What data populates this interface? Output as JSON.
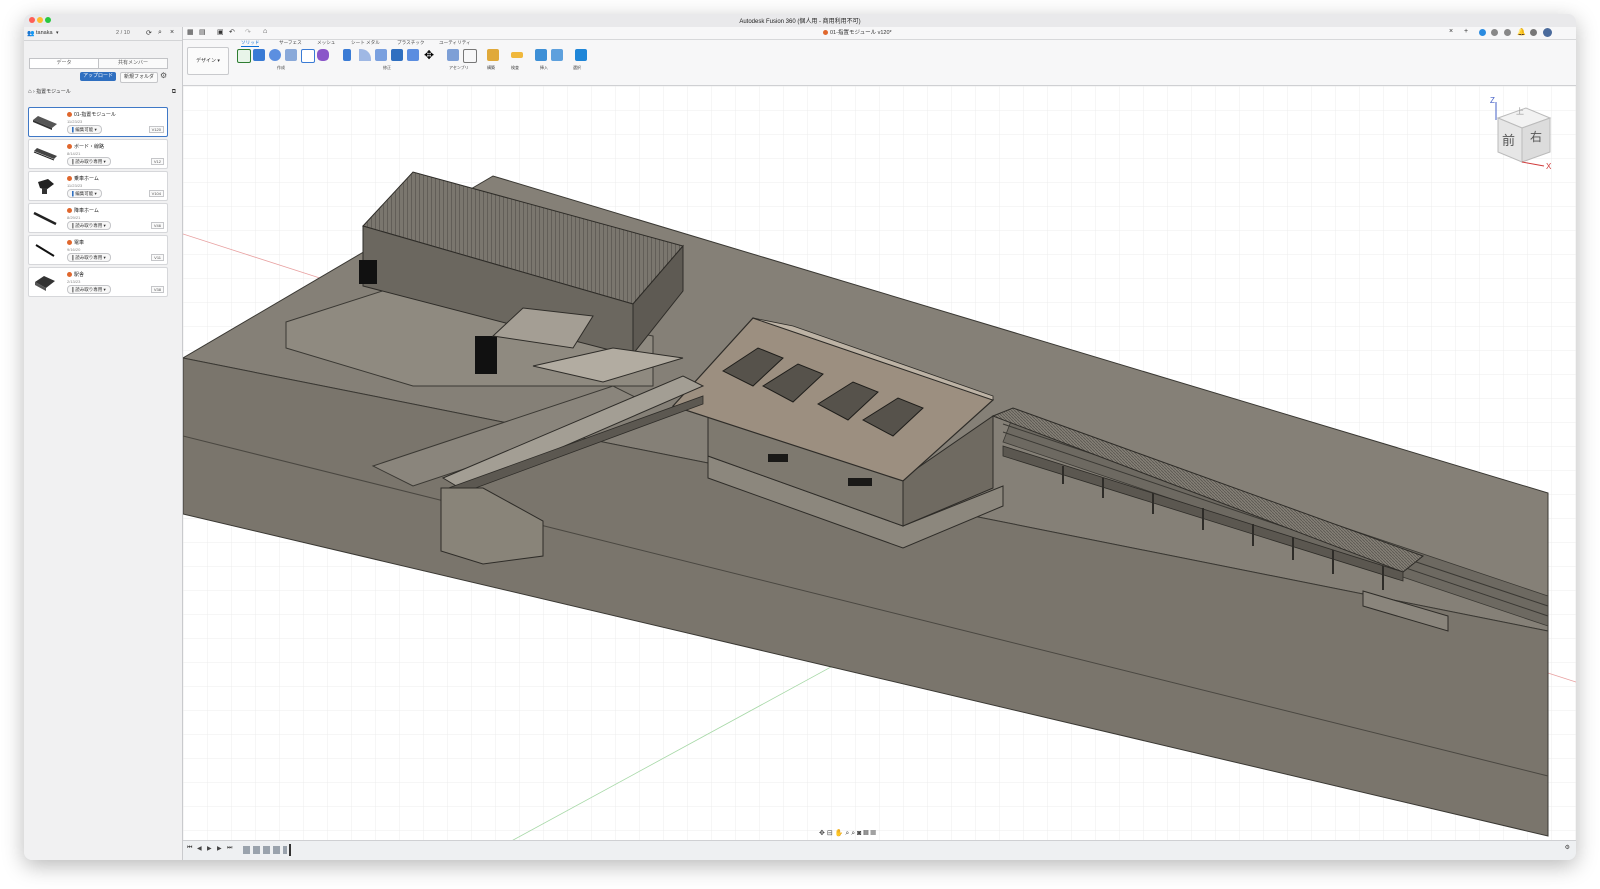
{
  "window": {
    "title": "Autodesk Fusion 360 (個人用 - 商用利用不可)",
    "document_tab": "01-指置モジュール v120*"
  },
  "sidebar": {
    "user": "tanaka",
    "job_status": "2 / 10",
    "tabs": [
      "データ",
      "共有メンバー"
    ],
    "upload_label": "アップロード",
    "new_folder_label": "新規フォルダ",
    "breadcrumb": "指置モジュール",
    "items": [
      {
        "name": "01-指置モジュール",
        "date": "11/23/23",
        "perm": "編集可能",
        "version": "V120",
        "selected": true
      },
      {
        "name": "ボード・線路",
        "date": "8/14/21",
        "perm": "読み取り専用",
        "version": "V12"
      },
      {
        "name": "乗車ホーム",
        "date": "11/23/23",
        "perm": "編集可能",
        "version": "V104"
      },
      {
        "name": "降車ホーム",
        "date": "8/29/21",
        "perm": "読み取り専用",
        "version": "V46"
      },
      {
        "name": "電車",
        "date": "9/16/20",
        "perm": "読み取り専用",
        "version": "V11"
      },
      {
        "name": "駅舎",
        "date": "2/13/23",
        "perm": "読み取り専用",
        "version": "V38"
      }
    ]
  },
  "toolbar": {
    "workspace": "デザイン",
    "tabs": [
      "ソリッド",
      "サーフェス",
      "メッシュ",
      "シート メタル",
      "プラスチック",
      "ユーティリティ"
    ],
    "active_tab": 0,
    "groups": [
      "作成",
      "修正",
      "アセンブリ",
      "構築",
      "検査",
      "挿入",
      "選択"
    ]
  },
  "viewcube": {
    "front": "前",
    "right": "右",
    "top": "上",
    "z": "Z",
    "x": "X"
  },
  "colors": {
    "accent": "#0b6ed6",
    "upload": "#2f6fc0",
    "model": "#8a857c",
    "model_dark": "#6f6a62",
    "grid": "#e3e3e3"
  }
}
